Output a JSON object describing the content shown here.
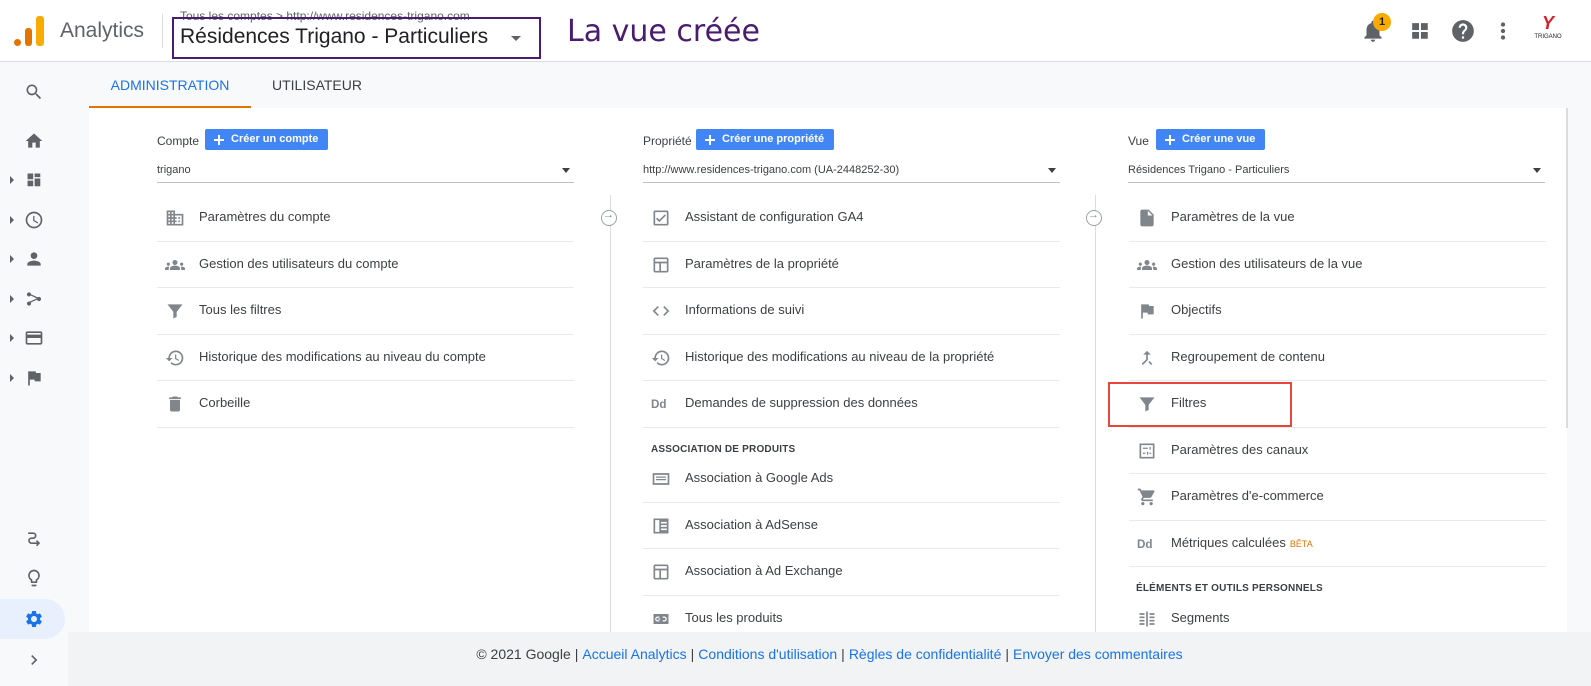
{
  "header": {
    "app_name": "Analytics",
    "breadcrumb": "Tous les comptes > http://www.residences-trigano.com",
    "view_name": "Résidences Trigano - Particuliers",
    "annotation": "La vue créée",
    "notification_count": "1",
    "brand_logo_text": "TRIGANO"
  },
  "tabs": [
    {
      "label": "ADMINISTRATION",
      "active": true
    },
    {
      "label": "UTILISATEUR",
      "active": false
    }
  ],
  "account_column": {
    "label": "Compte",
    "create_button": "Créer un compte",
    "selected": "trigano",
    "items": [
      {
        "label": "Paramètres du compte",
        "icon": "building-icon"
      },
      {
        "label": "Gestion des utilisateurs du compte",
        "icon": "users-icon"
      },
      {
        "label": "Tous les filtres",
        "icon": "filter-icon"
      },
      {
        "label": "Historique des modifications au niveau du compte",
        "icon": "history-icon"
      },
      {
        "label": "Corbeille",
        "icon": "trash-icon"
      }
    ]
  },
  "property_column": {
    "label": "Propriété",
    "create_button": "Créer une propriété",
    "selected": "http://www.residences-trigano.com (UA-2448252-30)",
    "items": [
      {
        "label": "Assistant de configuration GA4",
        "icon": "checklist-icon"
      },
      {
        "label": "Paramètres de la propriété",
        "icon": "layout-icon"
      },
      {
        "label": "Informations de suivi",
        "icon": "code-icon"
      },
      {
        "label": "Historique des modifications au niveau de la propriété",
        "icon": "history-icon"
      },
      {
        "label": "Demandes de suppression des données",
        "icon": "dd-icon"
      }
    ],
    "section_title": "ASSOCIATION DE PRODUITS",
    "section_items": [
      {
        "label": "Association à Google Ads",
        "icon": "ads-icon"
      },
      {
        "label": "Association à AdSense",
        "icon": "adsense-icon"
      },
      {
        "label": "Association à Ad Exchange",
        "icon": "adexchange-icon"
      },
      {
        "label": "Tous les produits",
        "icon": "link-icon"
      }
    ]
  },
  "view_column": {
    "label": "Vue",
    "create_button": "Créer une vue",
    "selected": "Résidences Trigano - Particuliers",
    "items": [
      {
        "label": "Paramètres de la vue",
        "icon": "document-icon"
      },
      {
        "label": "Gestion des utilisateurs de la vue",
        "icon": "users-icon"
      },
      {
        "label": "Objectifs",
        "icon": "flag-icon"
      },
      {
        "label": "Regroupement de contenu",
        "icon": "merge-icon"
      },
      {
        "label": "Filtres",
        "icon": "filter-icon"
      },
      {
        "label": "Paramètres des canaux",
        "icon": "channels-icon"
      },
      {
        "label": "Paramètres d'e-commerce",
        "icon": "cart-icon"
      },
      {
        "label": "Métriques calculées",
        "icon": "dd-icon",
        "badge": "BÊTA"
      }
    ],
    "section_title": "ÉLÉMENTS ET OUTILS PERSONNELS",
    "section_items": [
      {
        "label": "Segments",
        "icon": "segments-icon"
      }
    ]
  },
  "footer": {
    "copyright": "© 2021 Google",
    "links": [
      "Accueil Analytics",
      "Conditions d'utilisation",
      "Règles de confidentialité",
      "Envoyer des commentaires"
    ]
  },
  "colors": {
    "accent_blue": "#1a73e8",
    "button_blue": "#4285f4",
    "tab_underline": "#e37400",
    "annotation_purple": "#4a1c6e",
    "highlight_red": "#e8453c"
  }
}
